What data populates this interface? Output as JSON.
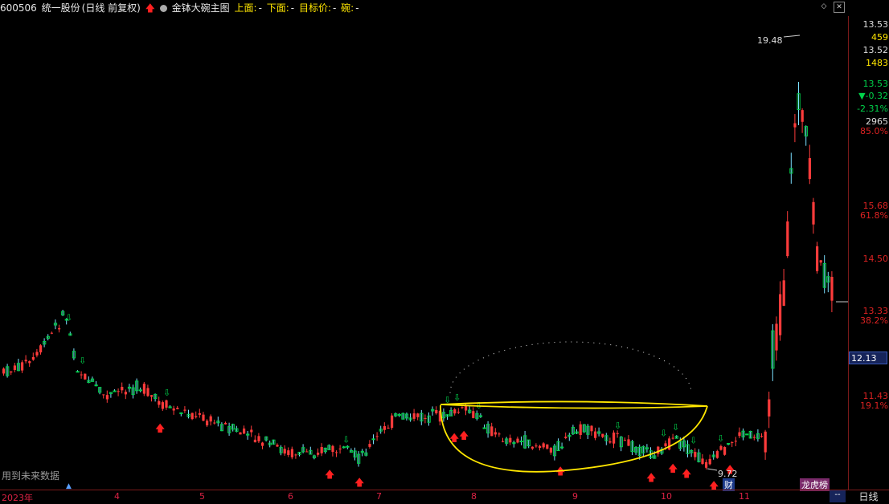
{
  "header": {
    "stock_code": "600506",
    "stock_name": "统一股份",
    "period_mode": "(日线 前复权)",
    "indicator_name": "金钵大碗主图",
    "upper_label": "上面:",
    "upper_value": "-",
    "lower_label": "下面:",
    "lower_value": "-",
    "target_label": "目标价:",
    "target_value": "-",
    "bowl_label": "碗:",
    "bowl_value": "-"
  },
  "right_axis": {
    "price_top": "13.53",
    "vol_top": "459",
    "price_2": "13.52",
    "vol_2": "1483",
    "price_3": "13.53",
    "change": "▼-0.32",
    "change_pct": "-2.31%",
    "vol_3": "2965",
    "fib_top": "85.0%",
    "level_1": "15.68",
    "level_1_pct": "61.8%",
    "level_2": "14.50",
    "level_3": "13.33",
    "level_3_pct": "38.2%",
    "current_price": "12.13",
    "level_4": "11.43",
    "level_4_pct": "19.1%"
  },
  "annotations": {
    "high": "19.48",
    "low": "9.72",
    "cai": "财",
    "longhu": "龙虎榜"
  },
  "x_axis": {
    "labels": [
      "2023年",
      "4",
      "5",
      "6",
      "7",
      "8",
      "9",
      "10",
      "11"
    ]
  },
  "period_tab": "日线",
  "future_label": "用到未来数据",
  "colors": {
    "up": "#ff3b3b",
    "down": "#00d24a",
    "axis": "#d22",
    "bowl": "#ffe600"
  }
}
